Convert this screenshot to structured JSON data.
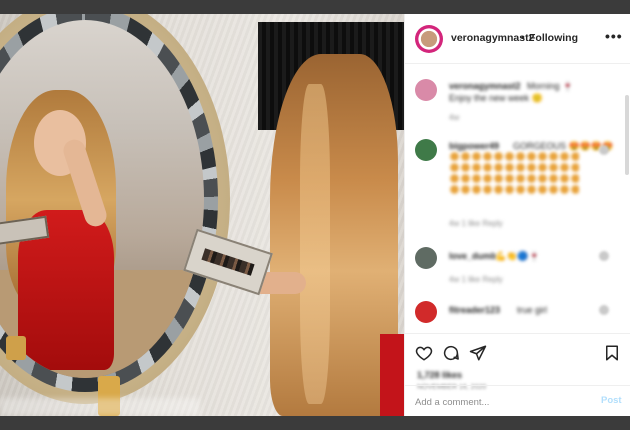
{
  "post": {
    "username": "veronagymnast2",
    "separator": "•",
    "follow_label": "Following",
    "more_label": "•••"
  },
  "comments": [
    {
      "user": "veronagymnast2",
      "text": "Morning 🍷",
      "line2": "Enjoy the new week 🙂",
      "meta": "4w"
    },
    {
      "user": "bigpower49",
      "text": "GORGEOUS 😍😍😍😍",
      "meta": "4w   1 like   Reply"
    },
    {
      "user": "love_dumb",
      "text": "💪👏🔵🍷",
      "meta": "4w   1 like   Reply"
    },
    {
      "user": "fitreader123",
      "text": "true girl",
      "meta": ""
    }
  ],
  "actions": {
    "like_icon": "heart-icon",
    "comment_icon": "comment-bubble-icon",
    "share_icon": "paper-plane-icon",
    "save_icon": "bookmark-icon",
    "likes_text": "1,728 likes",
    "date_text": "NOVEMBER 16, 2020"
  },
  "composer": {
    "placeholder": "Add a comment...",
    "post_label": "Post"
  },
  "colors": {
    "accent_post": "#b2dffc",
    "text": "#262626",
    "muted": "#8e8e8e",
    "dress_red": "#c3141a"
  }
}
